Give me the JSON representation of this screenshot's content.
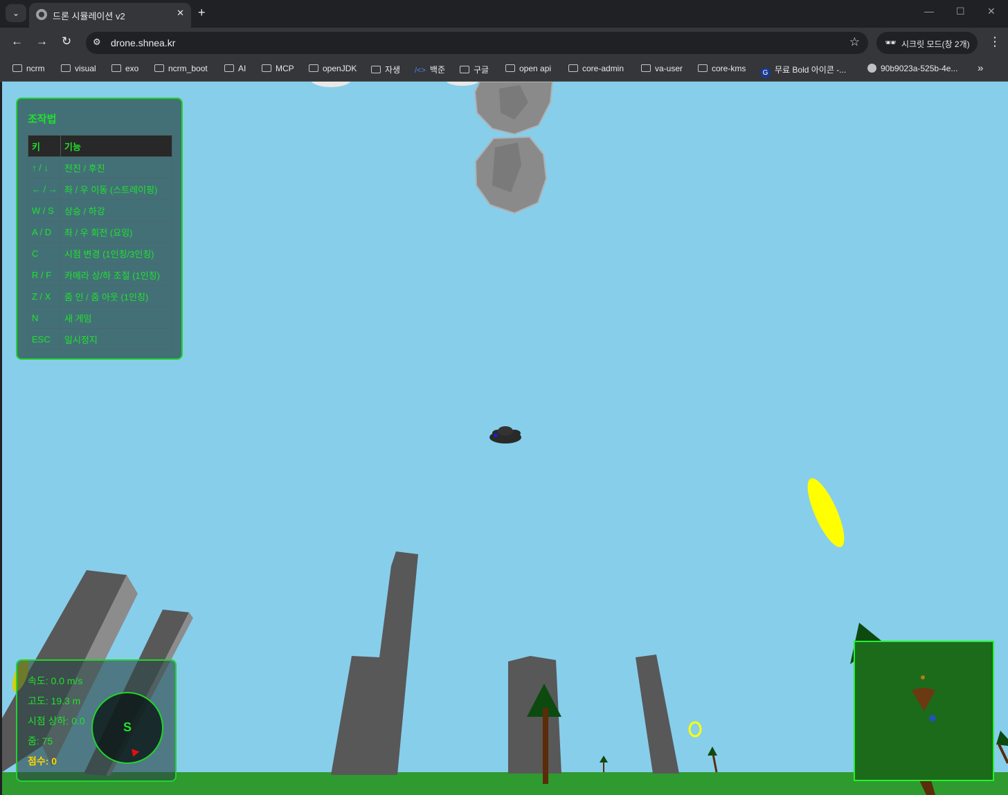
{
  "browser": {
    "tab_title": "드론 시뮬레이션 v2",
    "tab_close": "✕",
    "new_tab": "+",
    "tab_search_icon": "⌄",
    "window_minimize": "—",
    "window_maximize": "☐",
    "window_close": "✕",
    "back_icon": "←",
    "forward_icon": "→",
    "reload_icon": "↻",
    "site_info_icon": "⚙",
    "url": "drone.shnea.kr",
    "star_icon": "☆",
    "incognito_label": "시크릿 모드(창 2개)",
    "incognito_icon": "🕶",
    "menu_icon": "⋮",
    "more_bookmarks_icon": "»"
  },
  "bookmarks": [
    {
      "label": "ncrm",
      "icon": "folder"
    },
    {
      "label": "visual",
      "icon": "folder"
    },
    {
      "label": "exo",
      "icon": "folder"
    },
    {
      "label": "ncrm_boot",
      "icon": "folder"
    },
    {
      "label": "AI",
      "icon": "folder"
    },
    {
      "label": "MCP",
      "icon": "folder"
    },
    {
      "label": "openJDK",
      "icon": "folder"
    },
    {
      "label": "자생",
      "icon": "folder"
    },
    {
      "label": "백준",
      "icon": "code"
    },
    {
      "label": "구글",
      "icon": "folder"
    },
    {
      "label": "open api",
      "icon": "folder"
    },
    {
      "label": "core-admin",
      "icon": "folder"
    },
    {
      "label": "va-user",
      "icon": "folder"
    },
    {
      "label": "core-kms",
      "icon": "folder"
    },
    {
      "label": "무료 Bold 아이콘 -...",
      "icon": "pin"
    },
    {
      "label": "90b9023a-525b-4e...",
      "icon": "globe"
    }
  ],
  "controls": {
    "title": "조작법",
    "header_key": "키",
    "header_function": "기능",
    "rows": [
      {
        "key": "↑ / ↓",
        "func": "전진 / 후진"
      },
      {
        "key": "← / →",
        "func": "좌 / 우 이동 (스트레이핑)"
      },
      {
        "key": "W / S",
        "func": "상승 / 하강"
      },
      {
        "key": "A / D",
        "func": "좌 / 우 회전 (요잉)"
      },
      {
        "key": "C",
        "func": "시점 변경 (1인칭/3인칭)"
      },
      {
        "key": "R / F",
        "func": "카메라 상/하 조절 (1인칭)"
      },
      {
        "key": "Z / X",
        "func": "줌 인 / 줌 아웃 (1인칭)"
      },
      {
        "key": "N",
        "func": "새 게임"
      },
      {
        "key": "ESC",
        "func": "일시정지"
      }
    ]
  },
  "hud": {
    "speed": "속도: 0.0 m/s",
    "altitude": "고도: 19.3 m",
    "view_pitch": "시점 상하: 0.0",
    "zoom": "줌: 75",
    "score": "점수: 0",
    "compass_heading": "S"
  },
  "colors": {
    "sky": "#87ceeb",
    "ground": "#2f9a2f",
    "hud_green": "#1fe32b",
    "score_yellow": "#ffd400",
    "ring_yellow": "#ffff00",
    "building": "#585858",
    "minimap_bg": "#1b6b1b"
  }
}
